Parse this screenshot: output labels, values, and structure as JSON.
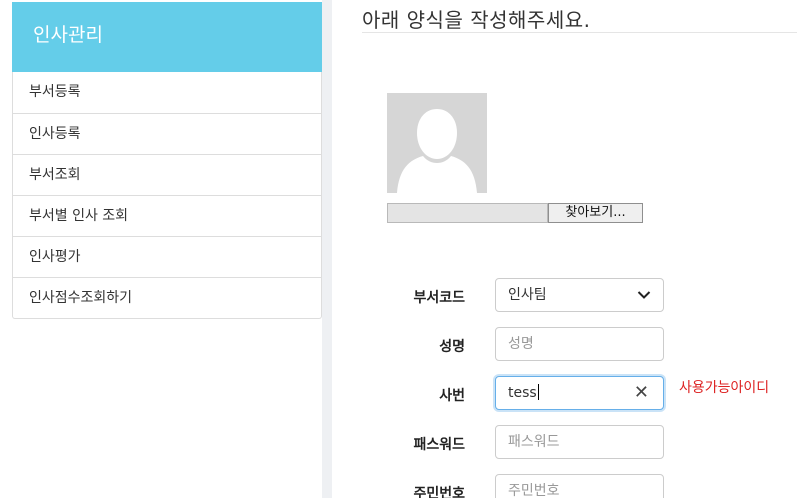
{
  "sidebar": {
    "title": "인사관리",
    "header_color": "#64cde9",
    "items": [
      {
        "label": "부서등록"
      },
      {
        "label": "인사등록"
      },
      {
        "label": "부서조회"
      },
      {
        "label": "부서별 인사 조회"
      },
      {
        "label": "인사평가"
      },
      {
        "label": "인사점수조회하기"
      }
    ]
  },
  "main": {
    "title": "아래 양식을 작성해주세요.",
    "photo": {
      "icon": "user-silhouette-icon",
      "browse_label": "찾아보기..."
    },
    "form": {
      "department": {
        "label": "부서코드",
        "value": "인사팀",
        "icon": "chevron-down-icon"
      },
      "name": {
        "label": "성명",
        "placeholder": "성명"
      },
      "employee_id": {
        "label": "사번",
        "value": "tess",
        "icon": "close-icon",
        "clear_symbol": "✕"
      },
      "id_status": {
        "text": "사용가능아이디",
        "color": "#dd2222"
      },
      "password": {
        "label": "패스워드",
        "placeholder": "패스워드"
      },
      "resident_number": {
        "label": "주민번호",
        "placeholder": "주민번호"
      }
    }
  }
}
